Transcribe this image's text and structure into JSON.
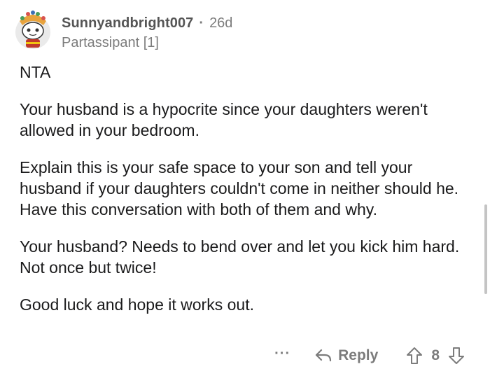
{
  "comment": {
    "username": "Sunnyandbright007",
    "separator": "·",
    "age": "26d",
    "flair": "Partassipant [1]",
    "paragraphs": [
      "NTA",
      "Your husband is a hypocrite since your daughters weren't allowed in your bedroom.",
      "Explain this is your safe space to your son and tell your husband if your daughters couldn't come in neither should he.  Have this conversation with both of them and why.",
      "Your husband?  Needs to bend over and let you kick him hard. Not once but twice!",
      "Good luck and hope it works out."
    ]
  },
  "actions": {
    "more": "···",
    "reply_label": "Reply",
    "vote_count": "8"
  },
  "icons": {
    "avatar": "snoo-avatar-icon",
    "reply": "reply-arrow-icon",
    "upvote": "upvote-arrow-icon",
    "downvote": "downvote-arrow-icon"
  }
}
